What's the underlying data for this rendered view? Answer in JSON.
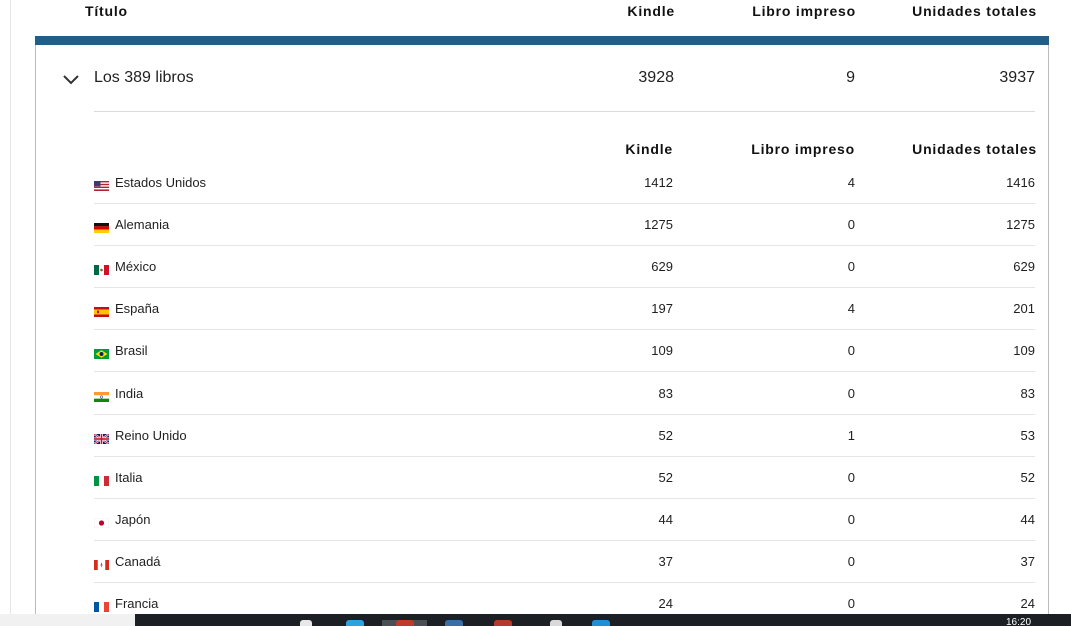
{
  "header": {
    "title_label": "Título",
    "kindle_label": "Kindle",
    "print_label": "Libro impreso",
    "total_label": "Unidades totales"
  },
  "book": {
    "title": "Los 389 libros",
    "kindle": "3928",
    "print": "9",
    "total": "3937"
  },
  "breakdown_header": {
    "kindle_label": "Kindle",
    "print_label": "Libro impreso",
    "total_label": "Unidades totales"
  },
  "rows": [
    {
      "country": "Estados Unidos",
      "flag": "us-flag-icon",
      "kindle": "1412",
      "print": "4",
      "total": "1416"
    },
    {
      "country": "Alemania",
      "flag": "de-flag-icon",
      "kindle": "1275",
      "print": "0",
      "total": "1275"
    },
    {
      "country": "México",
      "flag": "mx-flag-icon",
      "kindle": "629",
      "print": "0",
      "total": "629"
    },
    {
      "country": "España",
      "flag": "es-flag-icon",
      "kindle": "197",
      "print": "4",
      "total": "201"
    },
    {
      "country": "Brasil",
      "flag": "br-flag-icon",
      "kindle": "109",
      "print": "0",
      "total": "109"
    },
    {
      "country": "India",
      "flag": "in-flag-icon",
      "kindle": "83",
      "print": "0",
      "total": "83"
    },
    {
      "country": "Reino Unido",
      "flag": "gb-flag-icon",
      "kindle": "52",
      "print": "1",
      "total": "53"
    },
    {
      "country": "Italia",
      "flag": "it-flag-icon",
      "kindle": "52",
      "print": "0",
      "total": "52"
    },
    {
      "country": "Japón",
      "flag": "jp-flag-icon",
      "kindle": "44",
      "print": "0",
      "total": "44"
    },
    {
      "country": "Canadá",
      "flag": "ca-flag-icon",
      "kindle": "37",
      "print": "0",
      "total": "37"
    },
    {
      "country": "Francia",
      "flag": "fr-flag-icon",
      "kindle": "24",
      "print": "0",
      "total": "24"
    }
  ],
  "colors": {
    "accent_bar": "#235e86",
    "taskbar": "#1c2024"
  },
  "taskbar": {
    "clock": "16:20"
  }
}
